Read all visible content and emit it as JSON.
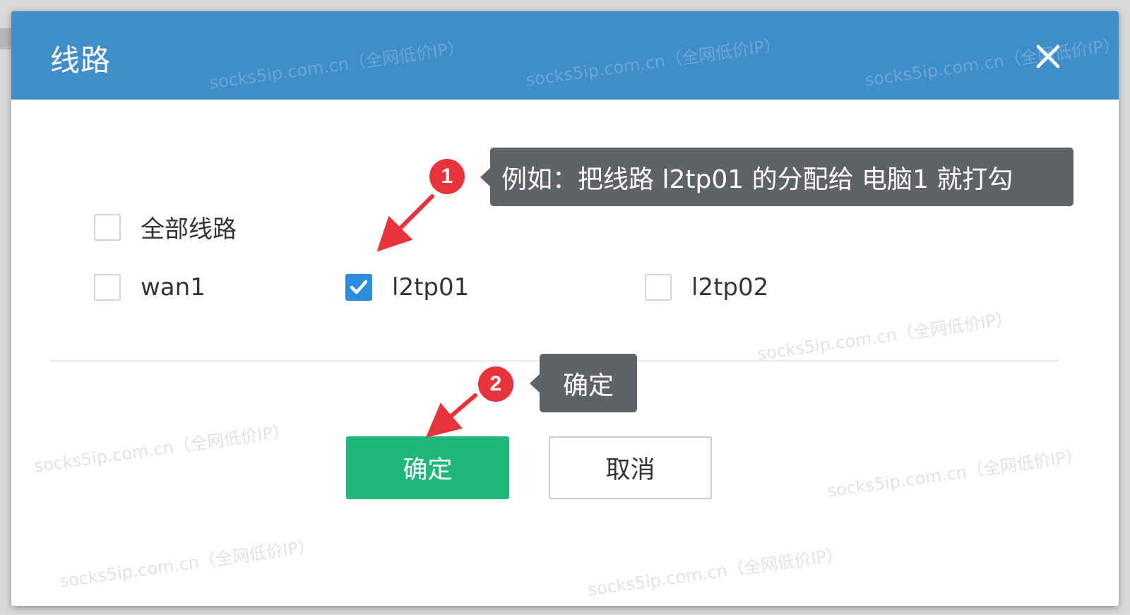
{
  "dialog": {
    "title": "线路",
    "close_icon": "close-icon"
  },
  "options": {
    "select_all": {
      "label": "全部线路",
      "checked": false
    },
    "items": [
      {
        "label": "wan1",
        "checked": false
      },
      {
        "label": "l2tp01",
        "checked": true
      },
      {
        "label": "l2tp02",
        "checked": false
      }
    ]
  },
  "buttons": {
    "confirm": "确定",
    "cancel": "取消"
  },
  "annotations": {
    "step1": {
      "badge": "1",
      "text": "例如：把线路 l2tp01 的分配给 电脑1 就打勾"
    },
    "step2": {
      "badge": "2",
      "text": "确定"
    }
  },
  "watermark": "socks5ip.com.cn（全网低价IP）",
  "colors": {
    "header": "#3f8ec9",
    "confirm_button": "#1db87a",
    "checkbox_checked": "#2c8ce0",
    "badge": "#e8333a",
    "tooltip": "#5f6266",
    "arrow": "#e8333a"
  }
}
